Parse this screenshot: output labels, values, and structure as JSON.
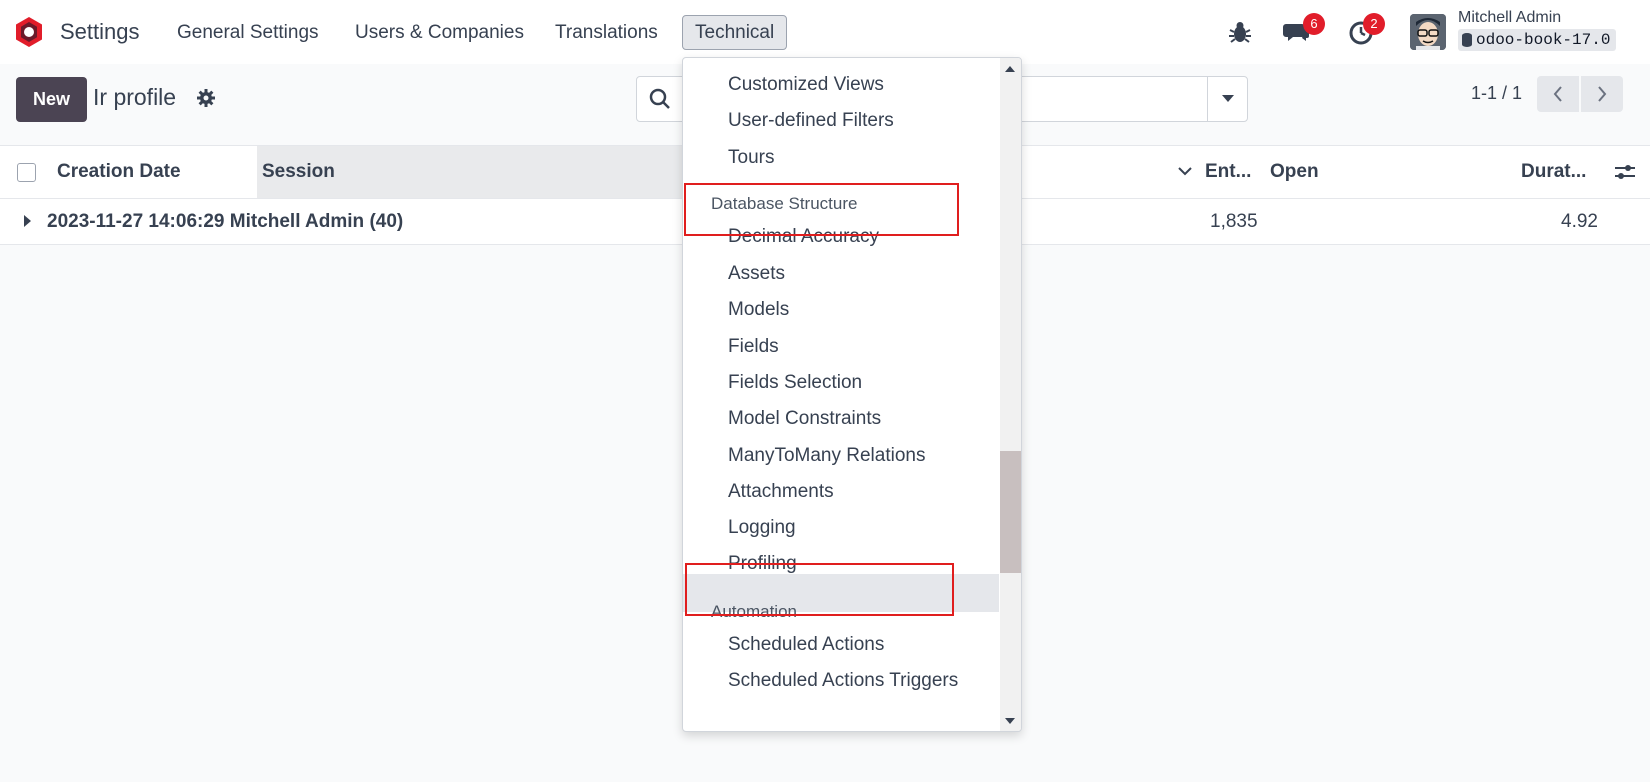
{
  "navbar": {
    "app_title": "Settings",
    "menu": [
      "General Settings",
      "Users & Companies",
      "Translations",
      "Technical"
    ],
    "icons": [
      "bug-icon",
      "chat-icon",
      "clock-icon"
    ],
    "messages_badge": "6",
    "activities_badge": "2",
    "user_name": "Mitchell Admin",
    "database": "odoo-book-17.0"
  },
  "control_panel": {
    "new_label": "New",
    "breadcrumb": "Ir profile",
    "pager": "1-1 / 1"
  },
  "list": {
    "columns": [
      "Creation Date",
      "Session",
      "Ent...",
      "Open",
      "Durat..."
    ],
    "group_row": {
      "label": "2023-11-27 14:06:29 Mitchell Admin (40)",
      "entries": "1,835",
      "duration": "4.92"
    }
  },
  "dropdown": {
    "items_top": [
      "Customized Views",
      "User-defined Filters",
      "Tours"
    ],
    "section_db": "Database Structure",
    "items_db": [
      "Decimal Accuracy",
      "Assets",
      "Models",
      "Fields",
      "Fields Selection",
      "Model Constraints",
      "ManyToMany Relations",
      "Attachments",
      "Logging",
      "Profiling"
    ],
    "section_auto": "Automation",
    "items_auto": [
      "Scheduled Actions",
      "Scheduled Actions Triggers"
    ]
  },
  "colors": {
    "brand": "#e11d2a",
    "new_button": "#4b4453",
    "highlight": "#e01e1e"
  }
}
